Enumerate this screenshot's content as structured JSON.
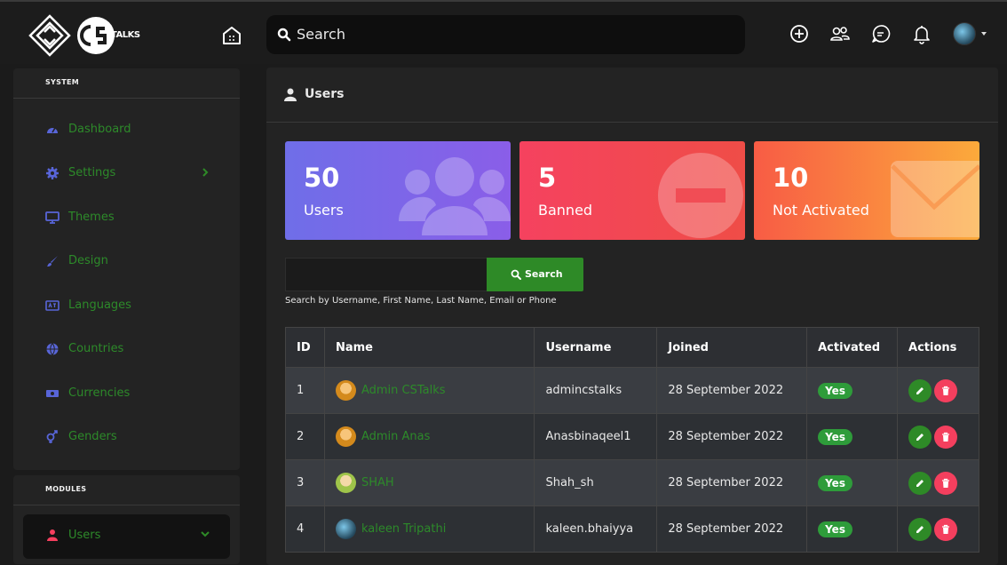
{
  "header": {
    "logo_text": "TALKS",
    "search_placeholder": "Search"
  },
  "sidebar": {
    "system_heading": "SYSTEM",
    "items": [
      {
        "label": "Dashboard",
        "icon": "dashboard-icon"
      },
      {
        "label": "Settings",
        "icon": "gear-icon"
      },
      {
        "label": "Themes",
        "icon": "monitor-icon"
      },
      {
        "label": "Design",
        "icon": "brush-icon"
      },
      {
        "label": "Languages",
        "icon": "language-icon"
      },
      {
        "label": "Countries",
        "icon": "globe-icon"
      },
      {
        "label": "Currencies",
        "icon": "money-icon"
      },
      {
        "label": "Genders",
        "icon": "gender-icon"
      }
    ],
    "modules_heading": "MODULES",
    "modules_item": {
      "label": "Users",
      "icon": "user-icon"
    }
  },
  "page": {
    "title": "Users"
  },
  "stats": [
    {
      "value": "50",
      "label": "Users"
    },
    {
      "value": "5",
      "label": "Banned"
    },
    {
      "value": "10",
      "label": "Not Activated"
    }
  ],
  "search": {
    "button_label": "Search",
    "hint": "Search by Username, First Name, Last Name, Email or Phone"
  },
  "table": {
    "headers": [
      "ID",
      "Name",
      "Username",
      "Joined",
      "Activated",
      "Actions"
    ],
    "rows": [
      {
        "id": "1",
        "name": "Admin CSTalks",
        "username": "admincstalks",
        "joined": "28 September 2022",
        "activated": "Yes"
      },
      {
        "id": "2",
        "name": "Admin Anas",
        "username": "Anasbinaqeel1",
        "joined": "28 September 2022",
        "activated": "Yes"
      },
      {
        "id": "3",
        "name": "SHAH",
        "username": "Shah_sh",
        "joined": "28 September 2022",
        "activated": "Yes"
      },
      {
        "id": "4",
        "name": "kaleen Tripathi",
        "username": "kaleen.bhaiyya",
        "joined": "28 September 2022",
        "activated": "Yes"
      }
    ]
  },
  "colors": {
    "accent": "#2e8a27",
    "danger": "#f43f5e",
    "card_users": "#7b66e8",
    "card_banned": "#f0454f",
    "card_not_activated": "#f98a40"
  }
}
